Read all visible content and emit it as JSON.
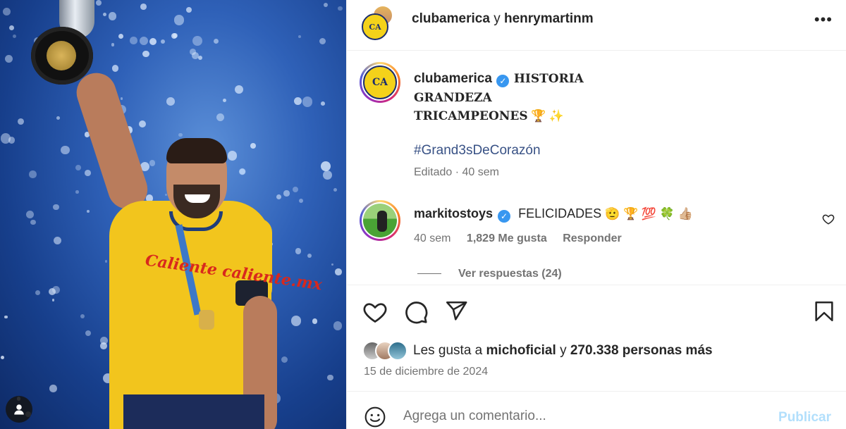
{
  "header": {
    "account1": "clubamerica",
    "connector": "y",
    "account2": "henrymartinm",
    "more_label": "•••"
  },
  "caption": {
    "username": "clubamerica",
    "verified": "✓",
    "line1": "HISTORIA",
    "line2": "GRANDEZA",
    "line3": "TRICAMPEONES",
    "line3_emoji": "🏆 ✨",
    "hashtag": "#Grand3sDeCorazón",
    "meta": "Editado · 40 sem"
  },
  "comment": {
    "username": "markitostoys",
    "verified": "✓",
    "text": "FELICIDADES",
    "emojis": "🫡 🏆 💯 🍀 👍🏼",
    "time": "40 sem",
    "likes": "1,829 Me gusta",
    "reply": "Responder",
    "view_replies": "Ver respuestas (24)"
  },
  "likes": {
    "prefix": "Les gusta a",
    "user": "michoficial",
    "middle": "y",
    "others": "270.338 personas más"
  },
  "date": "15 de diciembre de 2024",
  "add_comment": {
    "placeholder": "Agrega un comentario...",
    "publish": "Publicar"
  },
  "photo": {
    "sponsor": "Caliente caliente.mx"
  },
  "colors": {
    "link": "#385185",
    "muted": "#737373",
    "publish": "#b2dffc",
    "verified": "#3897f0",
    "club_yellow": "#f4d21a",
    "club_navy": "#1c2e6e"
  },
  "icons": [
    "heart-icon",
    "comment-icon",
    "share-icon",
    "bookmark-icon",
    "emoji-icon",
    "user-icon",
    "more-icon"
  ]
}
